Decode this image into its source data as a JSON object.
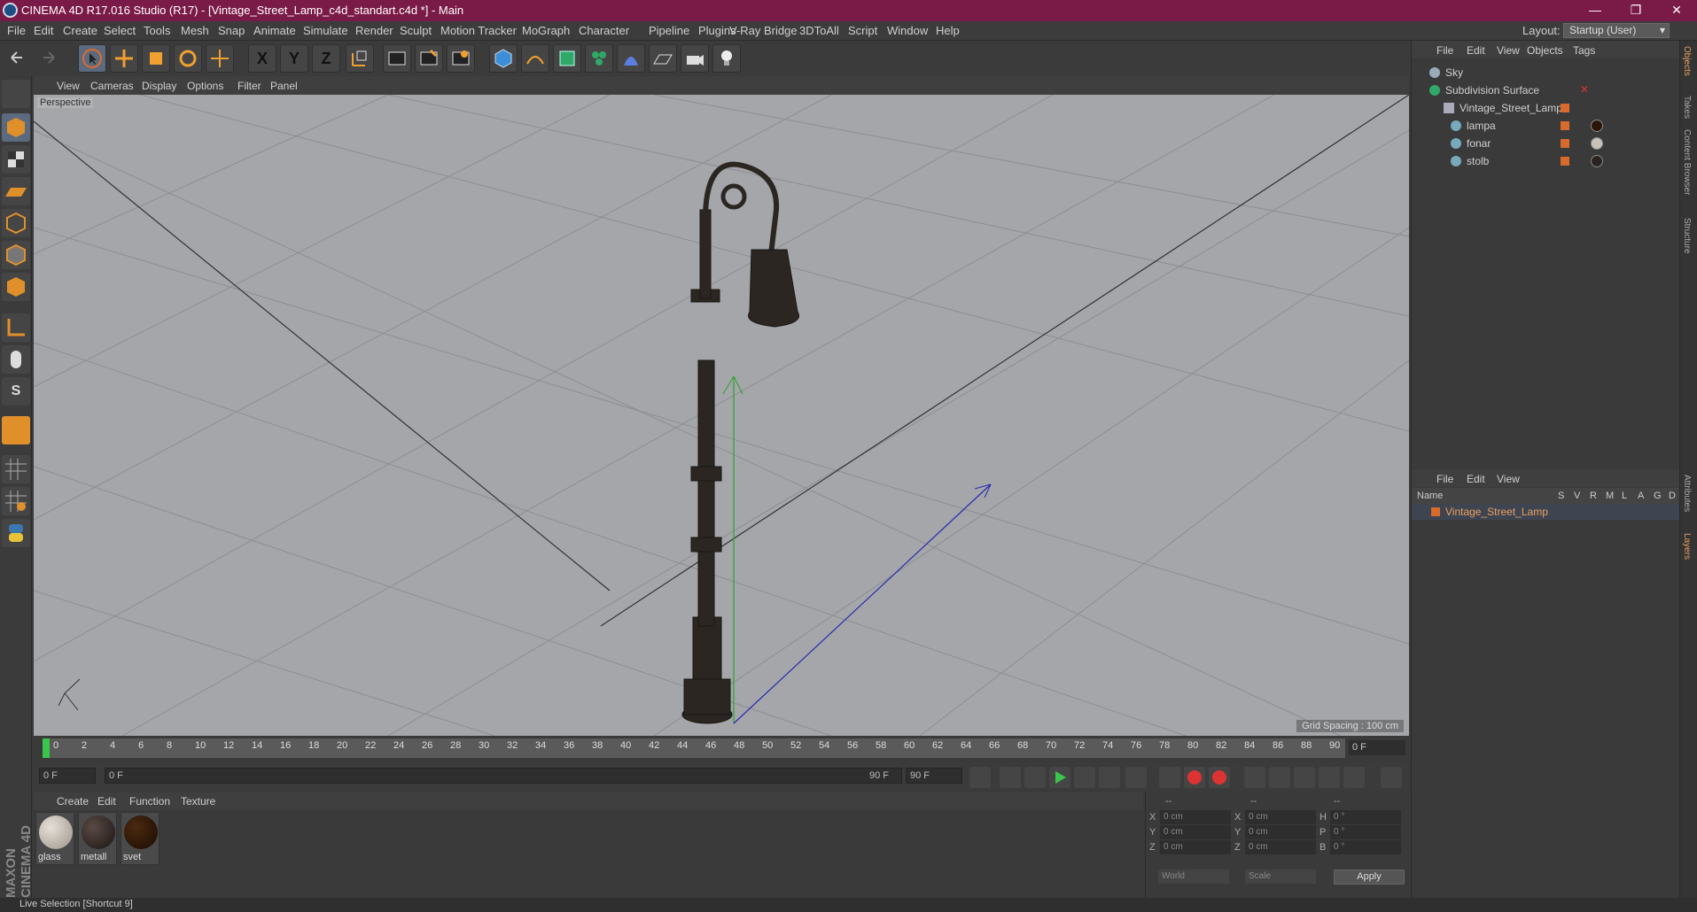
{
  "window": {
    "title": "CINEMA 4D R17.016 Studio (R17) - [Vintage_Street_Lamp_c4d_standart.c4d *] - Main",
    "min": "—",
    "max": "❐",
    "close": "✕"
  },
  "menu": {
    "items": [
      "File",
      "Edit",
      "Create",
      "Select",
      "Tools",
      "Mesh",
      "Snap",
      "Animate",
      "Simulate",
      "Render",
      "Sculpt",
      "Motion Tracker",
      "MoGraph",
      "Character",
      "Pipeline",
      "Plugins",
      "V-Ray Bridge",
      "3DToAll",
      "Script",
      "Window",
      "Help"
    ],
    "layout_label": "Layout:",
    "layout_value": "Startup (User)"
  },
  "toolbar": {
    "icons": [
      "undo-icon",
      "redo-icon",
      "live-selection-icon",
      "move-icon",
      "scale-icon",
      "rotate-icon",
      "move-axis-icon",
      "x-axis-icon",
      "y-axis-icon",
      "z-axis-icon",
      "coordinate-system-icon",
      "render-view-icon",
      "render-picture-viewer-icon",
      "render-settings-icon",
      "cube-icon",
      "pen-spline-icon",
      "subdivision-icon",
      "cloner-icon",
      "deformer-icon",
      "floor-icon",
      "camera-icon",
      "light-icon"
    ],
    "axis_labels": [
      "X",
      "Y",
      "Z"
    ]
  },
  "left_toolbar": {
    "icons": [
      "make-editable-icon",
      "model-mode-icon",
      "texture-mode-icon",
      "workplane-icon",
      "points-mode-icon",
      "edges-mode-icon",
      "polygons-mode-icon",
      "enable-axis-icon",
      "tweak-icon",
      "snap-icon",
      "magnet-icon",
      "grid-lock-icon",
      "lock-icon",
      "python-icon"
    ],
    "snap_label": "S"
  },
  "viewport": {
    "menu": [
      "View",
      "Cameras",
      "Display",
      "Options",
      "Filter",
      "Panel"
    ],
    "label": "Perspective",
    "grid_spacing": "Grid Spacing : 100 cm"
  },
  "timeline": {
    "ticks": [
      "0",
      "2",
      "4",
      "6",
      "8",
      "10",
      "12",
      "14",
      "16",
      "18",
      "20",
      "22",
      "24",
      "26",
      "28",
      "30",
      "32",
      "34",
      "36",
      "38",
      "40",
      "42",
      "44",
      "46",
      "48",
      "50",
      "52",
      "54",
      "56",
      "58",
      "60",
      "62",
      "64",
      "66",
      "68",
      "70",
      "72",
      "74",
      "76",
      "78",
      "80",
      "82",
      "84",
      "86",
      "88",
      "90"
    ],
    "current": "0 F"
  },
  "transport": {
    "start": "0 F",
    "range_start": "0 F",
    "range_end": "90 F",
    "end": "90 F"
  },
  "materials": {
    "menu": [
      "Create",
      "Edit",
      "Function",
      "Texture"
    ],
    "items": [
      {
        "name": "glass",
        "color": "#c9c2b8"
      },
      {
        "name": "metall",
        "color": "#2a2320"
      },
      {
        "name": "svet",
        "color": "#2a1508"
      }
    ]
  },
  "coords": {
    "header": [
      "--",
      "--",
      "--"
    ],
    "rows": [
      {
        "l1": "X",
        "v1": "0 cm",
        "l2": "X",
        "v2": "0 cm",
        "l3": "H",
        "v3": "0 °"
      },
      {
        "l1": "Y",
        "v1": "0 cm",
        "l2": "Y",
        "v2": "0 cm",
        "l3": "P",
        "v3": "0 °"
      },
      {
        "l1": "Z",
        "v1": "0 cm",
        "l2": "Z",
        "v2": "0 cm",
        "l3": "B",
        "v3": "0 °"
      }
    ],
    "world": "World",
    "scale": "Scale",
    "apply": "Apply"
  },
  "objects": {
    "menu": [
      "File",
      "Edit",
      "View",
      "Objects",
      "Tags"
    ],
    "rows": [
      "Sky",
      "Subdivision Surface",
      "Vintage_Street_Lamp",
      "lampa",
      "fonar",
      "stolb"
    ]
  },
  "layers": {
    "menu": [
      "File",
      "Edit",
      "View"
    ],
    "columns": [
      "Name",
      "S",
      "V",
      "R",
      "M",
      "L",
      "A",
      "G",
      "D"
    ],
    "row": "Vintage_Street_Lamp"
  },
  "right_tabs": [
    "Objects",
    "Takes",
    "Content Browser",
    "Structure",
    "Attributes",
    "Layers"
  ],
  "status": "Live Selection [Shortcut 9]",
  "colors": {
    "titlebar": "#7a1a47",
    "viewport": "#a4a6aa",
    "layer_orange": "#d86a2b"
  }
}
